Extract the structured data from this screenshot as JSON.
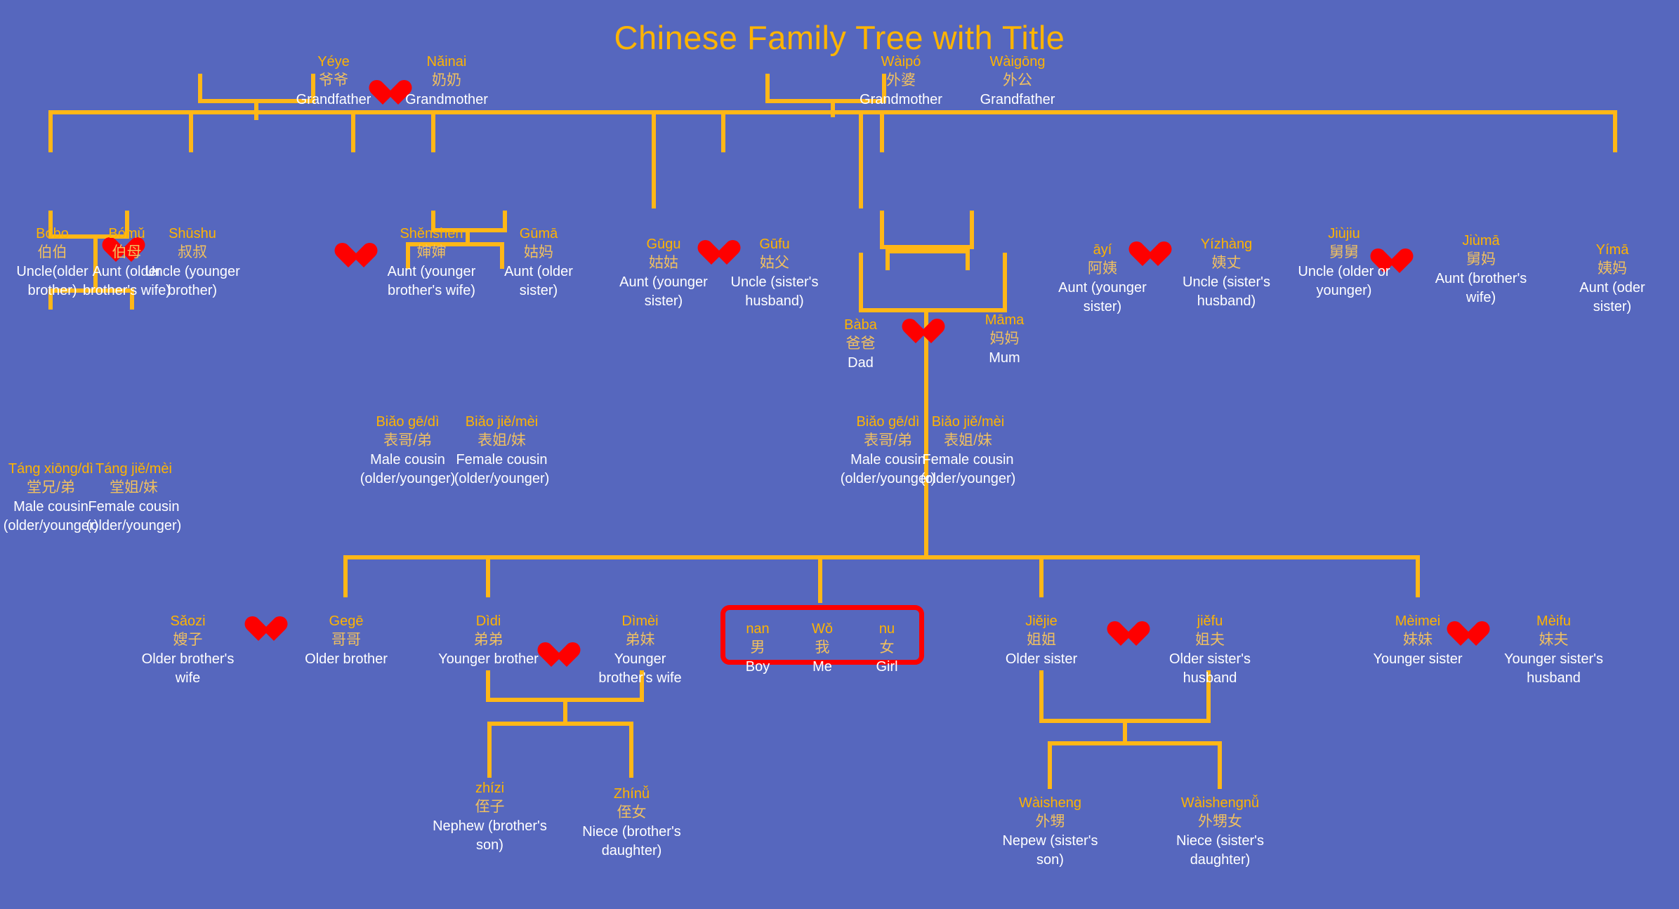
{
  "title": "Chinese Family Tree with Title",
  "theme": {
    "background": "#5667be",
    "line": "#ffb717",
    "pinyin": "#ffb400",
    "hanzi": "#f0c060",
    "english": "#ffffff",
    "heart": "#fe0000",
    "highlight_border": "#fd0000"
  },
  "people": {
    "yeye": {
      "pinyin": "Yéye",
      "hanzi": "爷爷",
      "english": "Grandfather"
    },
    "nainai": {
      "pinyin": "Nǎinai",
      "hanzi": "奶奶",
      "english": "Grandmother"
    },
    "waipo": {
      "pinyin": "Wàipó",
      "hanzi": "外婆",
      "english": "Grandmother"
    },
    "waigong": {
      "pinyin": "Wàigōng",
      "hanzi": "外公",
      "english": "Grandfather"
    },
    "bobo": {
      "pinyin": "Bóbo",
      "hanzi": "伯伯",
      "english": "Uncle(older brother)"
    },
    "bomu": {
      "pinyin": "Bómǔ",
      "hanzi": "伯母",
      "english": "Aunt (older brother's wife)"
    },
    "shushu": {
      "pinyin": "Shūshu",
      "hanzi": "叔叔",
      "english": "Uncle (younger brother)"
    },
    "shenshen": {
      "pinyin": "Shěnshen",
      "hanzi": "婶婶",
      "english": "Aunt (younger brother's wife)"
    },
    "guma": {
      "pinyin": "Gūmā",
      "hanzi": "姑妈",
      "english": "Aunt (older sister)"
    },
    "gugu": {
      "pinyin": "Gūgu",
      "hanzi": "姑姑",
      "english": "Aunt (younger sister)"
    },
    "gufu": {
      "pinyin": "Gūfu",
      "hanzi": "姑父",
      "english": "Uncle (sister's husband)"
    },
    "baba": {
      "pinyin": "Bàba",
      "hanzi": "爸爸",
      "english": "Dad"
    },
    "mama": {
      "pinyin": "Māma",
      "hanzi": "妈妈",
      "english": "Mum"
    },
    "ayi": {
      "pinyin": "āyí",
      "hanzi": "阿姨",
      "english": "Aunt (younger sister)"
    },
    "yizhang": {
      "pinyin": "Yízhàng",
      "hanzi": "姨丈",
      "english": "Uncle (sister's husband)"
    },
    "jiujiu": {
      "pinyin": "Jiùjiu",
      "hanzi": "舅舅",
      "english": "Uncle (older or younger)"
    },
    "jiuma": {
      "pinyin": "Jiùmā",
      "hanzi": "舅妈",
      "english": "Aunt (brother's wife)"
    },
    "yima": {
      "pinyin": "Yímā",
      "hanzi": "姨妈",
      "english": "Aunt (oder sister)"
    },
    "tangxiongdi": {
      "pinyin": "Táng xiōng/dì",
      "hanzi": "堂兄/弟",
      "english": "Male cousin (older/younger)"
    },
    "tangjiemei": {
      "pinyin": "Táng jiě/mèi",
      "hanzi": "堂姐/妹",
      "english": "Female cousin (older/younger)"
    },
    "biaogedi_l": {
      "pinyin": "Biǎo gē/dì",
      "hanzi": "表哥/弟",
      "english": "Male cousin (older/younger)"
    },
    "biaojiemei_l": {
      "pinyin": "Biǎo jiě/mèi",
      "hanzi": "表姐/妹",
      "english": "Female cousin (older/younger)"
    },
    "biaogedi_r": {
      "pinyin": "Biǎo gē/dì",
      "hanzi": "表哥/弟",
      "english": "Male cousin (older/younger)"
    },
    "biaojiemei_r": {
      "pinyin": "Biǎo jiě/mèi",
      "hanzi": "表姐/妹",
      "english": "Female cousin (older/younger)"
    },
    "saozi": {
      "pinyin": "Sǎozi",
      "hanzi": "嫂子",
      "english": "Older brother's wife"
    },
    "gege": {
      "pinyin": "Gegē",
      "hanzi": "哥哥",
      "english": "Older brother"
    },
    "didi": {
      "pinyin": "Dìdi",
      "hanzi": "弟弟",
      "english": "Younger brother"
    },
    "dimei": {
      "pinyin": "Dìmèi",
      "hanzi": "弟妹",
      "english": "Younger brother's wife"
    },
    "nan": {
      "pinyin": "nan",
      "hanzi": "男",
      "english": "Boy"
    },
    "wo": {
      "pinyin": "Wǒ",
      "hanzi": "我",
      "english": "Me"
    },
    "nu": {
      "pinyin": "nu",
      "hanzi": "女",
      "english": "Girl"
    },
    "jiejie": {
      "pinyin": "Jiějie",
      "hanzi": "姐姐",
      "english": "Older sister"
    },
    "jiefu": {
      "pinyin": "jiěfu",
      "hanzi": "姐夫",
      "english": "Older sister's husband"
    },
    "meimei": {
      "pinyin": "Mèimei",
      "hanzi": "妹妹",
      "english": "Younger sister"
    },
    "meifu": {
      "pinyin": "Mèifu",
      "hanzi": "妹夫",
      "english": "Younger sister's husband"
    },
    "zhizi": {
      "pinyin": "zhízi",
      "hanzi": "侄子",
      "english": "Nephew (brother's son)"
    },
    "zhinu": {
      "pinyin": "Zhínǚ",
      "hanzi": "侄女",
      "english": "Niece (brother's daughter)"
    },
    "waisheng": {
      "pinyin": "Wàisheng",
      "hanzi": "外甥",
      "english": "Nepew (sister's son)"
    },
    "waishengnu": {
      "pinyin": "Wàishengnǚ",
      "hanzi": "外甥女",
      "english": "Niece (sister's daughter)"
    }
  }
}
